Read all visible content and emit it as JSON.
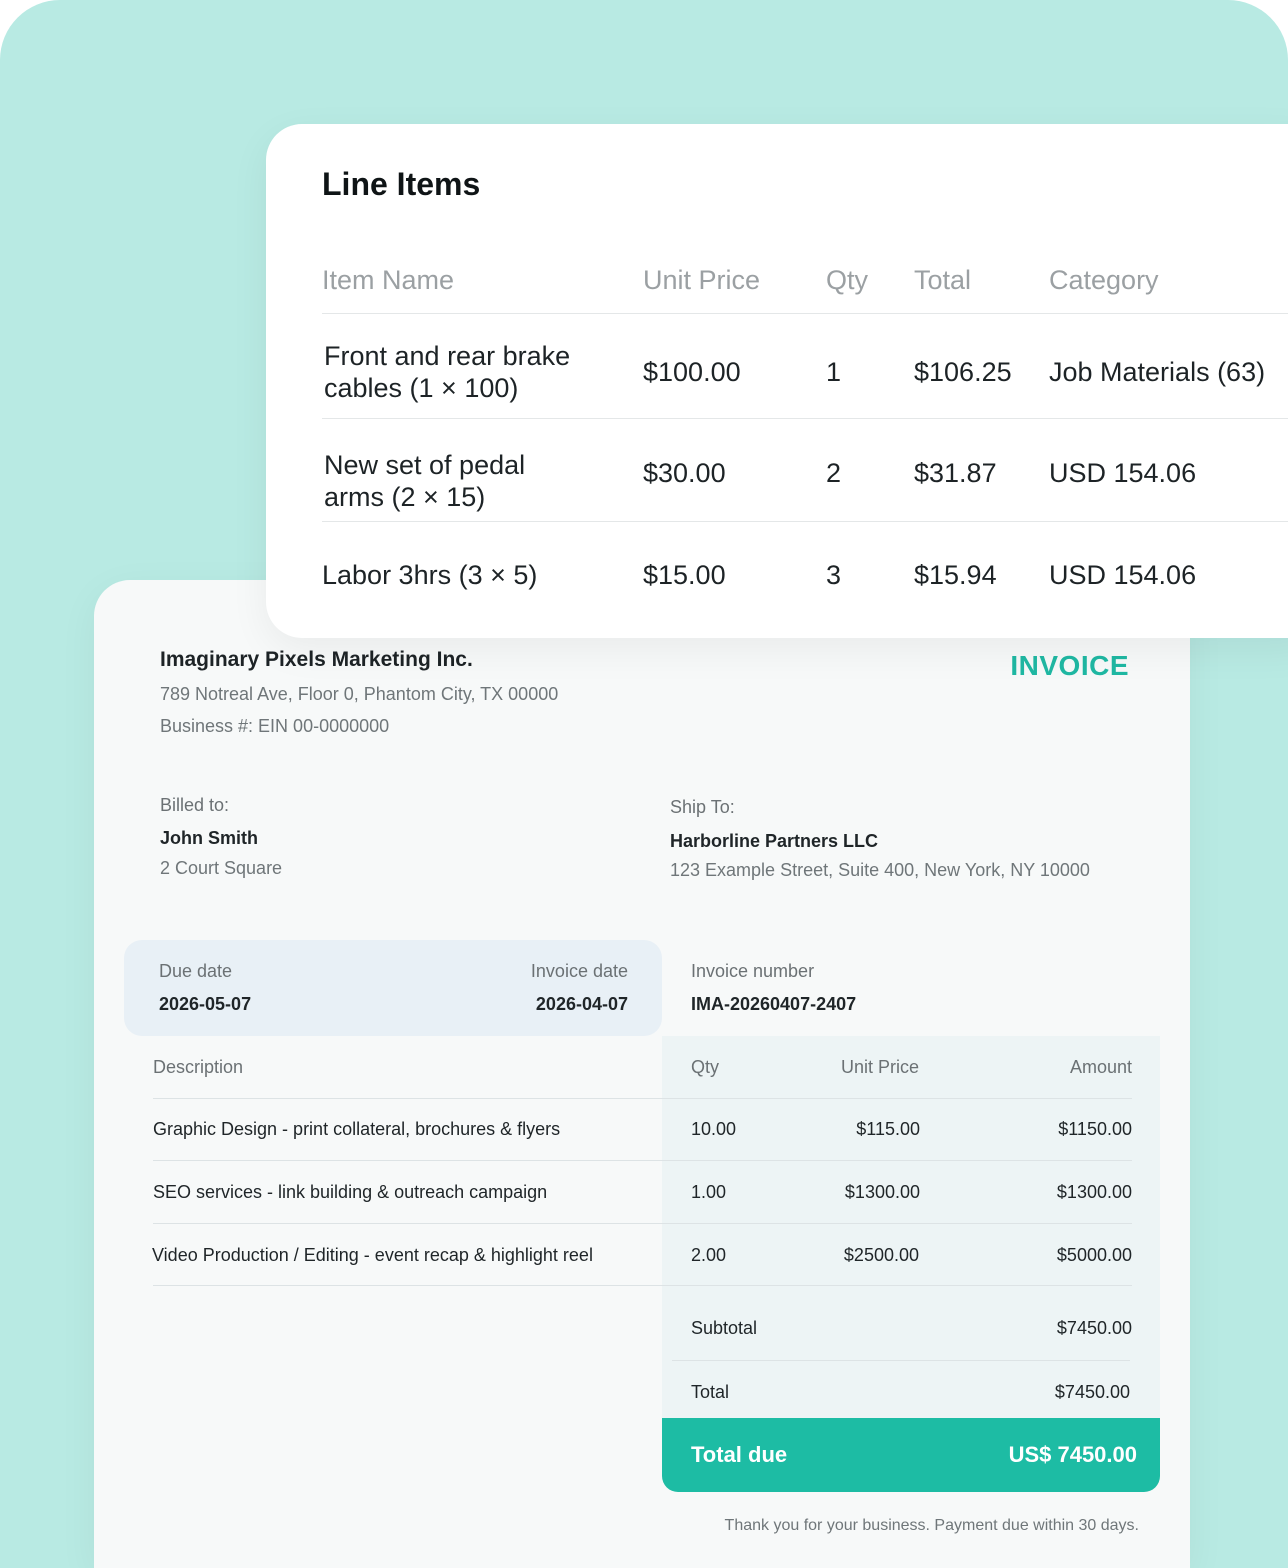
{
  "line_items_card": {
    "title": "Line Items",
    "headers": [
      "Item Name",
      "Unit Price",
      "Qty",
      "Total",
      "Category"
    ],
    "rows": [
      {
        "name_line1": "Front and rear brake",
        "name_line2": "cables (1 × 100)",
        "unit_price": "$100.00",
        "qty": "1",
        "total": "$106.25",
        "category": "Job Materials (63)"
      },
      {
        "name_line1": "New set of pedal",
        "name_line2": "arms (2 × 15)",
        "unit_price": "$30.00",
        "qty": "2",
        "total": "$31.87",
        "category": "USD 154.06"
      },
      {
        "name_line1": "Labor 3hrs (3 × 5)",
        "name_line2": "",
        "unit_price": "$15.00",
        "qty": "3",
        "total": "$15.94",
        "category": "USD 154.06"
      }
    ]
  },
  "invoice": {
    "company": "Imaginary Pixels Marketing Inc.",
    "address": "789 Notreal Ave, Floor 0, Phantom City, TX 00000",
    "business_number": "Business #: EIN 00-0000000",
    "title": "INVOICE",
    "billed_to": {
      "label": "Billed to:",
      "name": "John Smith",
      "address": "2 Court Square"
    },
    "ship_to": {
      "label": "Ship To:",
      "name": "Harborline Partners LLC",
      "address": "123 Example Street, Suite 400, New York, NY 10000"
    },
    "due_date": {
      "label": "Due date",
      "value": "2026-05-07"
    },
    "invoice_date": {
      "label": "Invoice date",
      "value": "2026-04-07"
    },
    "invoice_number": {
      "label": "Invoice number",
      "value": "IMA-20260407-2407"
    },
    "table_headers": {
      "description": "Description",
      "qty": "Qty",
      "unit_price": "Unit Price",
      "amount": "Amount"
    },
    "rows": [
      {
        "description": "Graphic Design - print collateral, brochures & flyers",
        "qty": "10.00",
        "unit_price": "$115.00",
        "amount": "$1150.00"
      },
      {
        "description": "SEO services - link building & outreach campaign",
        "qty": "1.00",
        "unit_price": "$1300.00",
        "amount": "$1300.00"
      },
      {
        "description": "Video Production / Editing - event recap & highlight reel",
        "qty": "2.00",
        "unit_price": "$2500.00",
        "amount": "$5000.00"
      }
    ],
    "subtotal": {
      "label": "Subtotal",
      "value": "$7450.00"
    },
    "total": {
      "label": "Total",
      "value": "$7450.00"
    },
    "total_due": {
      "label": "Total due",
      "value": "US$ 7450.00"
    },
    "footer_note": "Thank you for your business. Payment due within 30 days."
  },
  "colors": {
    "background": "#b8eae3",
    "accent": "#1dbca4",
    "invoice_title": "#1fb8a3"
  }
}
